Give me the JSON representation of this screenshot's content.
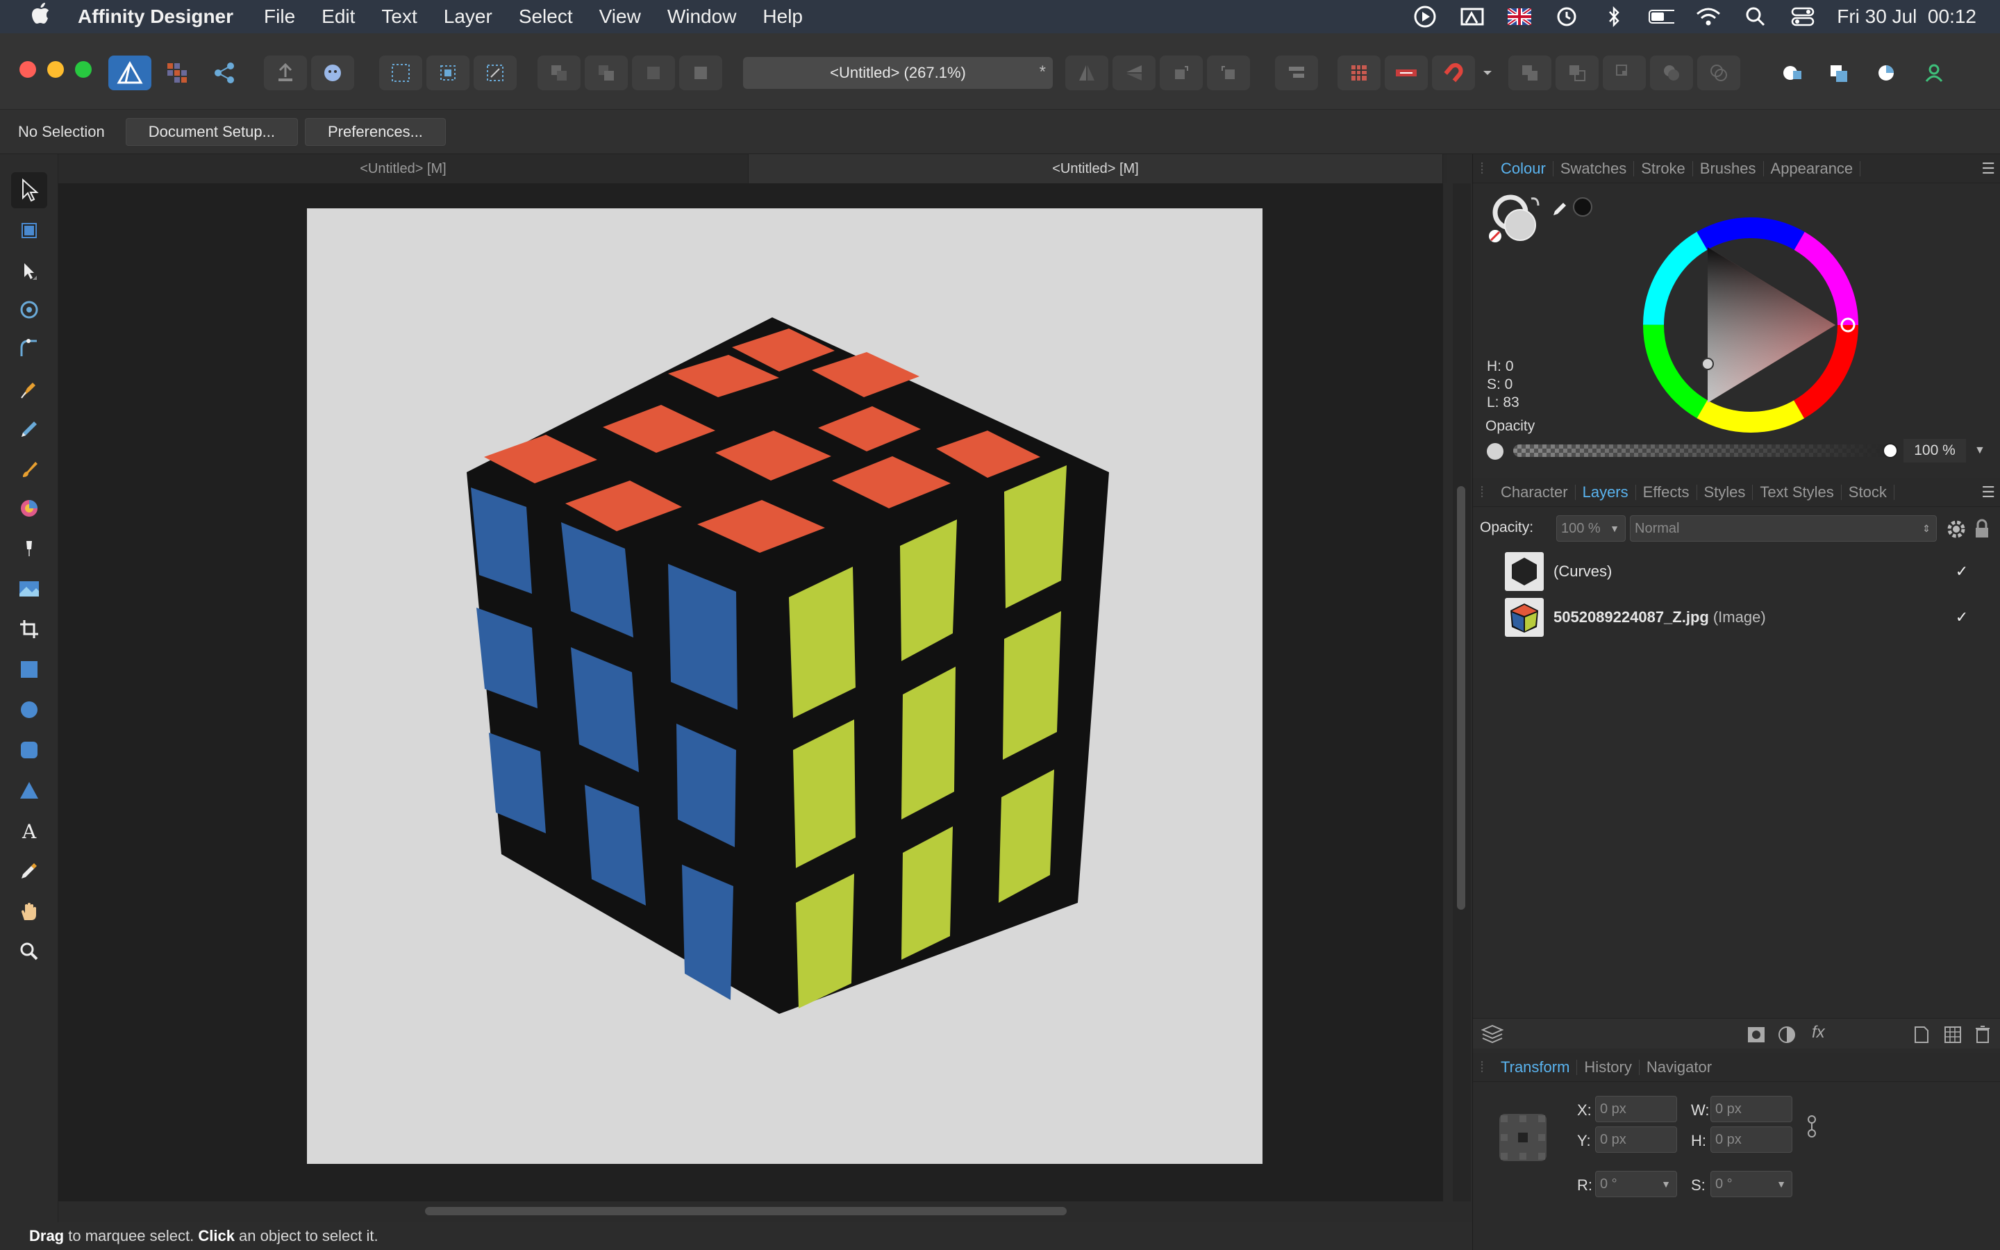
{
  "menubar": {
    "app": "Affinity Designer",
    "items": [
      "File",
      "Edit",
      "Text",
      "Layer",
      "Select",
      "View",
      "Window",
      "Help"
    ],
    "clock": "Fri 30 Jul  00:12"
  },
  "toolbar": {
    "document_title": "<Untitled> (267.1%)",
    "modified_marker": "*"
  },
  "context": {
    "selection": "No Selection",
    "document_setup": "Document Setup...",
    "preferences": "Preferences..."
  },
  "doc_tabs": [
    "<Untitled> [M]",
    "<Untitled> [M]"
  ],
  "colour_panel": {
    "tabs": [
      "Colour",
      "Swatches",
      "Stroke",
      "Brushes",
      "Appearance"
    ],
    "h": "H: 0",
    "s": "S: 0",
    "l": "L: 83",
    "opacity_label": "Opacity",
    "opacity_value": "100 %"
  },
  "layers_panel": {
    "tabs": [
      "Character",
      "Layers",
      "Effects",
      "Styles",
      "Text Styles",
      "Stock"
    ],
    "opacity_label": "Opacity:",
    "opacity_value": "100 %",
    "blend_mode": "Normal",
    "layers": [
      {
        "name": "(Curves)",
        "type": ""
      },
      {
        "name": "5052089224087_Z.jpg",
        "type": "(Image)"
      }
    ]
  },
  "transform_panel": {
    "tabs": [
      "Transform",
      "History",
      "Navigator"
    ],
    "x_label": "X:",
    "x_value": "0 px",
    "y_label": "Y:",
    "y_value": "0 px",
    "w_label": "W:",
    "w_value": "0 px",
    "h_label": "H:",
    "h_value": "0 px",
    "r_label": "R:",
    "r_value": "0 °",
    "s_label": "S:",
    "s_value": "0 °"
  },
  "status": {
    "drag": "Drag",
    "drag_text": " to marquee select. ",
    "click": "Click",
    "click_text": " an object to select it."
  },
  "colors": {
    "accent": "#5ab4f0",
    "cube_red": "#e2583a",
    "cube_blue": "#2f5fa0",
    "cube_yellow": "#b8cc3c"
  }
}
